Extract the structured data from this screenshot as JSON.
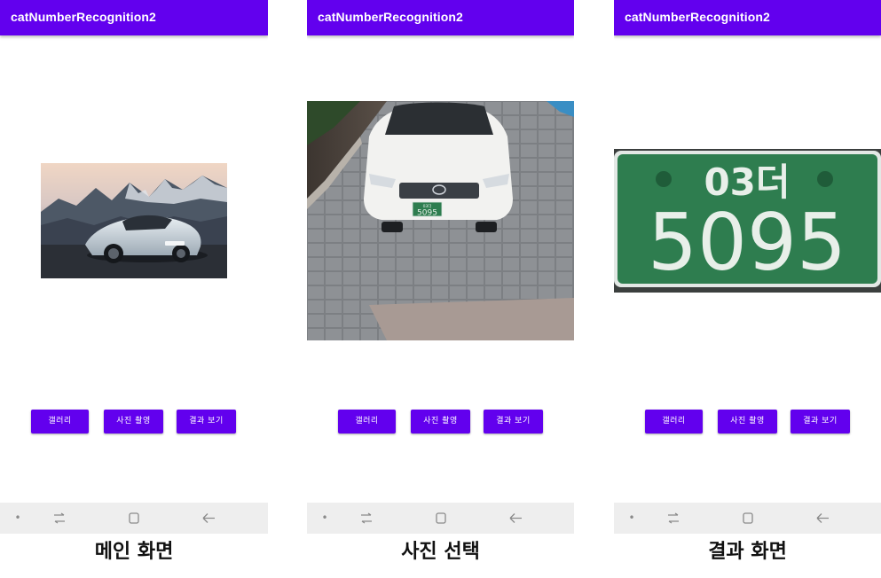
{
  "screens": [
    {
      "app_title": "catNumberRecognition2",
      "buttons": {
        "gallery": "갤러리",
        "camera": "사진 촬영",
        "result": "결과 보기"
      },
      "caption": "메인 화면",
      "image": "sports-car-photo"
    },
    {
      "app_title": "catNumberRecognition2",
      "buttons": {
        "gallery": "갤러리",
        "camera": "사진 촬영",
        "result": "결과 보기"
      },
      "caption": "사진 선택",
      "image": "sedan-photo",
      "plate_small": {
        "top": "03더",
        "number": "5095"
      }
    },
    {
      "app_title": "catNumberRecognition2",
      "buttons": {
        "gallery": "갤러리",
        "camera": "사진 촬영",
        "result": "결과 보기"
      },
      "caption": "결과 화면",
      "image": "license-plate-crop",
      "plate": {
        "top": "03더",
        "number": "5095"
      }
    }
  ],
  "icons": {
    "nav_dot": "dot-icon",
    "nav_recent": "recent-apps-icon",
    "nav_home": "home-icon",
    "nav_back": "back-arrow-icon"
  },
  "colors": {
    "primary": "#6200ee",
    "navbar": "#eeeeee",
    "plate_green": "#2e7d4f"
  }
}
